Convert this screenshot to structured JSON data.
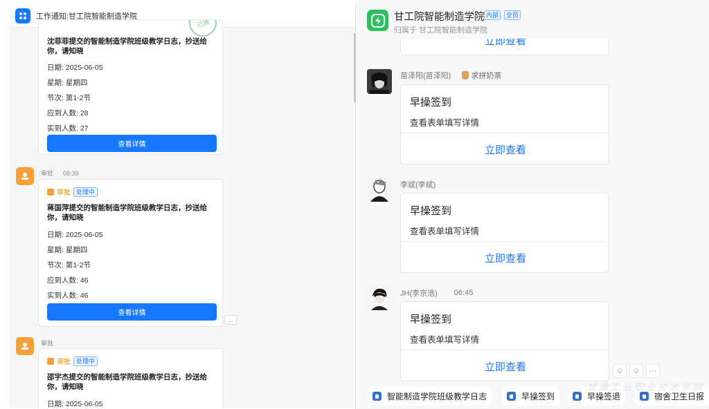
{
  "left": {
    "header_title": "工作通知:甘工院智能制造学院",
    "messages": [
      {
        "sender": "",
        "time": "",
        "stamp": "已通",
        "title": "沈菲菲提交的智能制造学院班级教学日志，抄送给你，请知晓",
        "fields": [
          "日期: 2025-06-05",
          "星期: 星期四",
          "节次: 第1-2节",
          "应到人数: 28",
          "实到人数: 27"
        ],
        "button": "查看详情"
      },
      {
        "sender": "审批",
        "time": "09:39",
        "tag": "审批",
        "status": "处理中",
        "title": "蒋国萍提交的智能制造学院班级教学日志，抄送给你，请知晓",
        "fields": [
          "日期: 2025-06-05",
          "星期: 星期四",
          "节次: 第1-2节",
          "应到人数: 46",
          "实到人数: 46"
        ],
        "button": "查看详情",
        "more": "..."
      },
      {
        "sender": "审批",
        "time": "",
        "tag": "审批",
        "status": "处理中",
        "title": "邵宇杰提交的智能制造学院班级教学日志，抄送给你，请知晓",
        "fields": [
          "日期: 2025-06-05"
        ]
      }
    ]
  },
  "right": {
    "group_name": "甘工院智能制造学院",
    "badge_internal": "内部",
    "badge_all": "全员",
    "subtitle": "归属于 甘工院智能制造学院",
    "messages": [
      {
        "sender": "",
        "time": "",
        "status": "",
        "title": "",
        "sub": "",
        "link": "立即查看"
      },
      {
        "sender": "苗泽阳(苗泽阳)",
        "time": "",
        "status": "求拼奶茶",
        "title": "早操签到",
        "sub": "查看表单填写详情",
        "link": "立即查看"
      },
      {
        "sender": "李斌(李斌)",
        "time": "",
        "status": "",
        "title": "早操签到",
        "sub": "查看表单填写详情",
        "link": "立即查看"
      },
      {
        "sender": "JH(李京浩)",
        "time": "06:45",
        "status": "",
        "title": "早操签到",
        "sub": "查看表单填写详情",
        "link": "立即查看"
      }
    ],
    "reactions": [
      "☺",
      "☺",
      "···"
    ],
    "shortcuts": [
      "智能制造学院班级教学日志",
      "早操签到",
      "早操签退",
      "宿舍卫生日报"
    ],
    "watermark": "甘肃工业职业技术学院"
  },
  "colors": {
    "accent": "#1677ff",
    "approval": "#f5a03b",
    "group": "#2fbf5e"
  },
  "icons": [
    "app-grid-icon",
    "approval-stamp-icon",
    "group-lightning-icon",
    "milk-tea-icon",
    "emoji-icon",
    "form-icon"
  ]
}
